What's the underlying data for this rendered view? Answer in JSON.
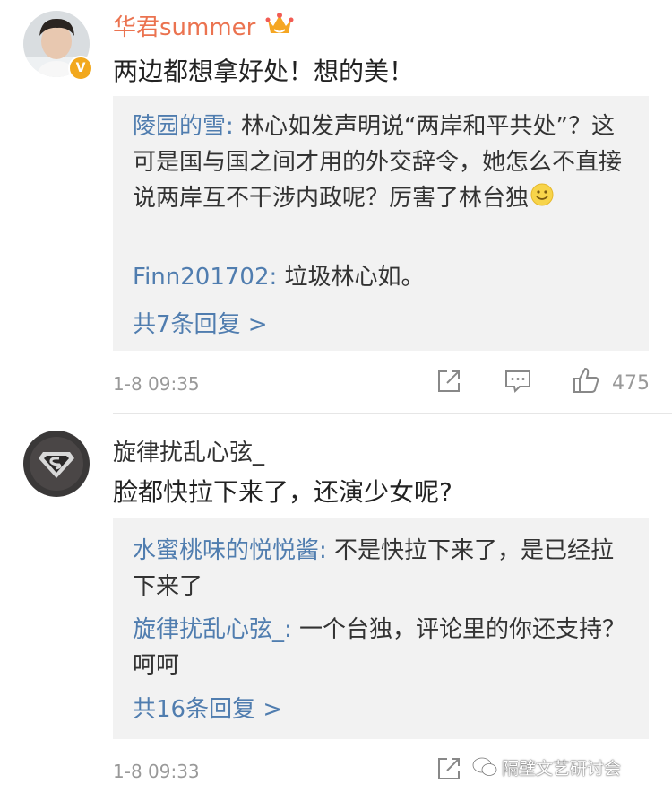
{
  "comments": [
    {
      "user": "华君summer",
      "vip_badge_icon": "crown-icon",
      "verified_icon": "verified-v-icon",
      "text": "两边都想拿好处！想的美！",
      "replies": [
        {
          "name": "陵园的雪:",
          "text": " 林心如发声明说“两岸和平共处”？这可是国与国之间才用的外交辞令，她怎么不直接说两岸互不干涉内政呢？厉害了林台独",
          "emoji": "smile-emoji-icon"
        },
        {
          "name": "Finn201702:",
          "text": " 垃圾林心如。"
        }
      ],
      "more": "共7条回复 >",
      "time": "1-8 09:35",
      "likes": "475"
    },
    {
      "user": "旋律扰乱心弦_",
      "avatar_icon": "superman-logo-icon",
      "text": "脸都快拉下来了，还演少女呢?",
      "replies": [
        {
          "name": "水蜜桃味的悦悦酱:",
          "text": " 不是快拉下来了，是已经拉下来了"
        },
        {
          "name": "旋律扰乱心弦_:",
          "text": " 一个台独，评论里的你还支持？呵呵"
        }
      ],
      "more": "共16条回复 >",
      "time": "1-8 09:33"
    }
  ],
  "watermark": "隔壁文艺研讨会",
  "colors": {
    "link": "#507daf",
    "vip_name": "#eb7350",
    "reply_bg": "#f2f2f2",
    "meta": "#999999"
  }
}
